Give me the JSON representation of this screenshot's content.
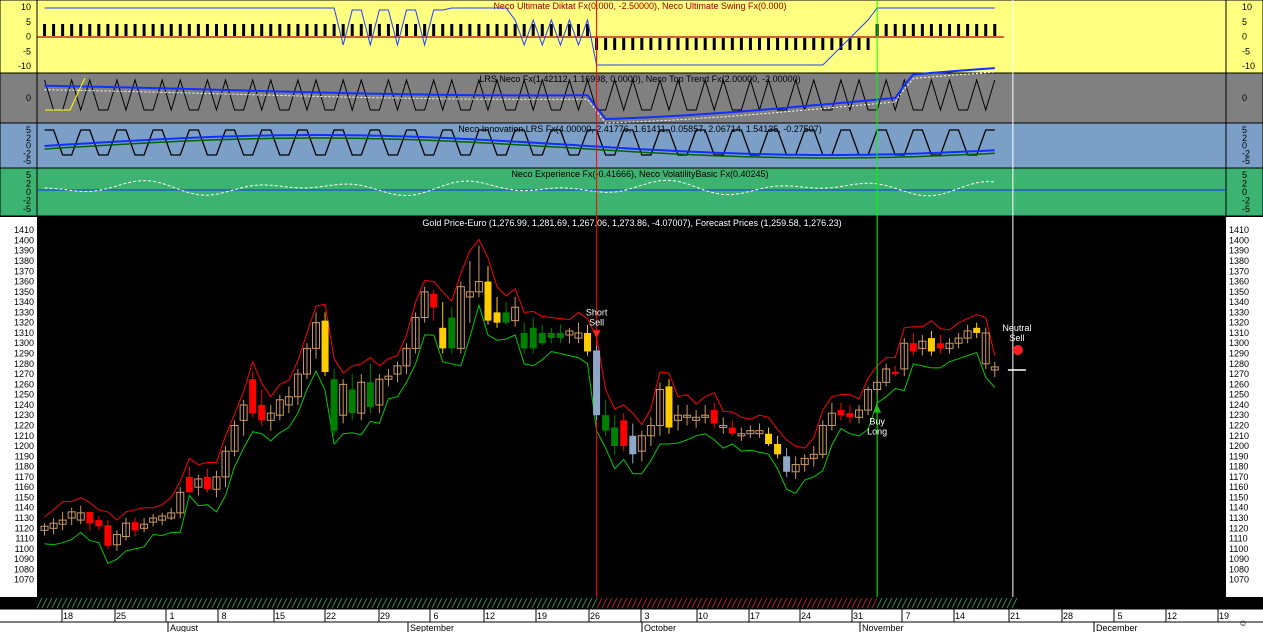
{
  "colors": {
    "panel1": "#ffff80",
    "panel2": "#808080",
    "panel3": "#7b9fc6",
    "panel4": "#3cb371",
    "price_bg": "#000000",
    "axis_bg": "#ffffff",
    "up_candle": "#ffffff",
    "down_red": "#ff0000",
    "green_candle": "#008000",
    "gold_candle": "#ffcc00",
    "blue_candle": "#8fa8c8",
    "upper_band": "#ff0000",
    "lower_band": "#00cc00",
    "vline_short": "#ff0000",
    "vline_buy": "#00ff00",
    "vline_current": "#ffffff"
  },
  "panels": [
    {
      "title": "Neco Ultimate Diktat Fx(0.000, -2.50000), Neco Ultimate Swing Fx(0.000)",
      "yticks": [
        "10",
        "5",
        "0",
        "-5",
        "-10"
      ]
    },
    {
      "title": "LRS Neco Fx(1.42112, 1.16998, 0.0000), Neco Top Trend Fx(2.00000, -2.00000)",
      "yticks": [
        "0"
      ]
    },
    {
      "title": "Neco Innovation LRS Fx(4.00000, 2.41776, 1.61411, 0.05857, 2.06714, 1.54135, -0.27507)",
      "yticks": [
        "5",
        "2",
        "0",
        "-2",
        "-5"
      ]
    },
    {
      "title": "Neco Experience Fx(-0.41666), Neco VolatilityBasic Fx(0.40245)",
      "yticks": [
        "5",
        "2",
        "0",
        "-2",
        "-5"
      ]
    }
  ],
  "chart_data": {
    "type": "candlestick",
    "title": "Gold Price-Euro (1,276.99, 1,281.69, 1,267.06, 1,273.86, -4.07007), Forecast Prices (1,259.58, 1,276.23)",
    "ylim": [
      1060,
      1415
    ],
    "yticks": [
      1410,
      1400,
      1390,
      1380,
      1370,
      1360,
      1350,
      1340,
      1330,
      1320,
      1310,
      1300,
      1290,
      1280,
      1270,
      1260,
      1250,
      1240,
      1230,
      1220,
      1210,
      1200,
      1190,
      1180,
      1170,
      1160,
      1150,
      1140,
      1130,
      1120,
      1110,
      1100,
      1090,
      1080,
      1070
    ],
    "x_day_labels": [
      "18",
      "25",
      "1",
      "8",
      "15",
      "22",
      "29",
      "6",
      "12",
      "19",
      "26",
      "3",
      "10",
      "17",
      "24",
      "31",
      "7",
      "14",
      "21",
      "28",
      "5",
      "12",
      "19"
    ],
    "x_month_labels": [
      "August",
      "September",
      "October",
      "November",
      "December"
    ],
    "candles": [
      {
        "o": 1118,
        "h": 1125,
        "l": 1113,
        "c": 1122,
        "t": "up"
      },
      {
        "o": 1120,
        "h": 1130,
        "l": 1114,
        "c": 1125,
        "t": "up"
      },
      {
        "o": 1124,
        "h": 1136,
        "l": 1118,
        "c": 1128,
        "t": "up"
      },
      {
        "o": 1130,
        "h": 1140,
        "l": 1123,
        "c": 1136,
        "t": "up"
      },
      {
        "o": 1135,
        "h": 1142,
        "l": 1124,
        "c": 1128,
        "t": "up"
      },
      {
        "o": 1125,
        "h": 1135,
        "l": 1118,
        "c": 1136,
        "t": "red"
      },
      {
        "o": 1128,
        "h": 1132,
        "l": 1118,
        "c": 1122,
        "t": "red"
      },
      {
        "o": 1123,
        "h": 1128,
        "l": 1100,
        "c": 1103,
        "t": "red"
      },
      {
        "o": 1104,
        "h": 1118,
        "l": 1098,
        "c": 1114,
        "t": "up"
      },
      {
        "o": 1112,
        "h": 1130,
        "l": 1108,
        "c": 1125,
        "t": "up"
      },
      {
        "o": 1126,
        "h": 1130,
        "l": 1112,
        "c": 1118,
        "t": "red"
      },
      {
        "o": 1120,
        "h": 1130,
        "l": 1116,
        "c": 1124,
        "t": "up"
      },
      {
        "o": 1126,
        "h": 1134,
        "l": 1122,
        "c": 1130,
        "t": "up"
      },
      {
        "o": 1128,
        "h": 1135,
        "l": 1123,
        "c": 1132,
        "t": "up"
      },
      {
        "o": 1130,
        "h": 1140,
        "l": 1128,
        "c": 1135,
        "t": "up"
      },
      {
        "o": 1135,
        "h": 1160,
        "l": 1130,
        "c": 1155,
        "t": "up"
      },
      {
        "o": 1170,
        "h": 1180,
        "l": 1160,
        "c": 1155,
        "t": "red"
      },
      {
        "o": 1160,
        "h": 1172,
        "l": 1152,
        "c": 1168,
        "t": "up"
      },
      {
        "o": 1170,
        "h": 1178,
        "l": 1155,
        "c": 1158,
        "t": "red"
      },
      {
        "o": 1158,
        "h": 1176,
        "l": 1150,
        "c": 1170,
        "t": "up"
      },
      {
        "o": 1170,
        "h": 1200,
        "l": 1160,
        "c": 1195,
        "t": "up"
      },
      {
        "o": 1195,
        "h": 1225,
        "l": 1190,
        "c": 1220,
        "t": "up"
      },
      {
        "o": 1225,
        "h": 1245,
        "l": 1210,
        "c": 1240,
        "t": "up"
      },
      {
        "o": 1265,
        "h": 1272,
        "l": 1228,
        "c": 1232,
        "t": "red"
      },
      {
        "o": 1240,
        "h": 1255,
        "l": 1220,
        "c": 1225,
        "t": "red"
      },
      {
        "o": 1225,
        "h": 1240,
        "l": 1215,
        "c": 1232,
        "t": "up"
      },
      {
        "o": 1230,
        "h": 1250,
        "l": 1225,
        "c": 1245,
        "t": "up"
      },
      {
        "o": 1240,
        "h": 1258,
        "l": 1232,
        "c": 1248,
        "t": "up"
      },
      {
        "o": 1248,
        "h": 1275,
        "l": 1240,
        "c": 1270,
        "t": "up"
      },
      {
        "o": 1270,
        "h": 1300,
        "l": 1265,
        "c": 1295,
        "t": "up"
      },
      {
        "o": 1295,
        "h": 1330,
        "l": 1285,
        "c": 1320,
        "t": "up"
      },
      {
        "o": 1322,
        "h": 1330,
        "l": 1268,
        "c": 1272,
        "t": "gold"
      },
      {
        "o": 1265,
        "h": 1275,
        "l": 1210,
        "c": 1215,
        "t": "green"
      },
      {
        "o": 1230,
        "h": 1265,
        "l": 1222,
        "c": 1260,
        "t": "up"
      },
      {
        "o": 1255,
        "h": 1270,
        "l": 1225,
        "c": 1232,
        "t": "green"
      },
      {
        "o": 1232,
        "h": 1270,
        "l": 1225,
        "c": 1262,
        "t": "up"
      },
      {
        "o": 1262,
        "h": 1280,
        "l": 1232,
        "c": 1238,
        "t": "green"
      },
      {
        "o": 1240,
        "h": 1270,
        "l": 1232,
        "c": 1265,
        "t": "up"
      },
      {
        "o": 1265,
        "h": 1275,
        "l": 1258,
        "c": 1268,
        "t": "up"
      },
      {
        "o": 1270,
        "h": 1282,
        "l": 1262,
        "c": 1278,
        "t": "up"
      },
      {
        "o": 1278,
        "h": 1300,
        "l": 1270,
        "c": 1295,
        "t": "up"
      },
      {
        "o": 1295,
        "h": 1330,
        "l": 1290,
        "c": 1325,
        "t": "up"
      },
      {
        "o": 1325,
        "h": 1355,
        "l": 1320,
        "c": 1350,
        "t": "up"
      },
      {
        "o": 1348,
        "h": 1352,
        "l": 1322,
        "c": 1335,
        "t": "red"
      },
      {
        "o": 1315,
        "h": 1340,
        "l": 1290,
        "c": 1295,
        "t": "gold"
      },
      {
        "o": 1325,
        "h": 1335,
        "l": 1290,
        "c": 1295,
        "t": "green"
      },
      {
        "o": 1295,
        "h": 1360,
        "l": 1290,
        "c": 1355,
        "t": "up"
      },
      {
        "o": 1345,
        "h": 1380,
        "l": 1320,
        "c": 1350,
        "t": "up"
      },
      {
        "o": 1350,
        "h": 1395,
        "l": 1345,
        "c": 1360,
        "t": "up"
      },
      {
        "o": 1360,
        "h": 1375,
        "l": 1318,
        "c": 1322,
        "t": "gold"
      },
      {
        "o": 1330,
        "h": 1345,
        "l": 1315,
        "c": 1320,
        "t": "gold"
      },
      {
        "o": 1330,
        "h": 1340,
        "l": 1318,
        "c": 1320,
        "t": "green"
      },
      {
        "o": 1322,
        "h": 1345,
        "l": 1316,
        "c": 1335,
        "t": "up"
      },
      {
        "o": 1310,
        "h": 1320,
        "l": 1290,
        "c": 1295,
        "t": "green"
      },
      {
        "o": 1315,
        "h": 1325,
        "l": 1290,
        "c": 1295,
        "t": "green"
      },
      {
        "o": 1310,
        "h": 1318,
        "l": 1298,
        "c": 1300,
        "t": "green"
      },
      {
        "o": 1305,
        "h": 1315,
        "l": 1300,
        "c": 1310,
        "t": "green"
      },
      {
        "o": 1310,
        "h": 1318,
        "l": 1300,
        "c": 1305,
        "t": "green"
      },
      {
        "o": 1308,
        "h": 1315,
        "l": 1300,
        "c": 1312,
        "t": "up"
      },
      {
        "o": 1310,
        "h": 1320,
        "l": 1300,
        "c": 1305,
        "t": "up"
      },
      {
        "o": 1310,
        "h": 1318,
        "l": 1288,
        "c": 1292,
        "t": "gold"
      },
      {
        "o": 1293,
        "h": 1298,
        "l": 1225,
        "c": 1230,
        "t": "blue"
      },
      {
        "o": 1230,
        "h": 1245,
        "l": 1210,
        "c": 1215,
        "t": "green"
      },
      {
        "o": 1218,
        "h": 1230,
        "l": 1192,
        "c": 1200,
        "t": "green"
      },
      {
        "o": 1200,
        "h": 1232,
        "l": 1195,
        "c": 1225,
        "t": "red"
      },
      {
        "o": 1210,
        "h": 1222,
        "l": 1183,
        "c": 1192,
        "t": "blue"
      },
      {
        "o": 1195,
        "h": 1215,
        "l": 1185,
        "c": 1210,
        "t": "up"
      },
      {
        "o": 1210,
        "h": 1228,
        "l": 1200,
        "c": 1220,
        "t": "up"
      },
      {
        "o": 1220,
        "h": 1262,
        "l": 1210,
        "c": 1255,
        "t": "up"
      },
      {
        "o": 1258,
        "h": 1265,
        "l": 1212,
        "c": 1218,
        "t": "gold"
      },
      {
        "o": 1225,
        "h": 1240,
        "l": 1215,
        "c": 1230,
        "t": "up"
      },
      {
        "o": 1230,
        "h": 1240,
        "l": 1220,
        "c": 1228,
        "t": "up"
      },
      {
        "o": 1225,
        "h": 1235,
        "l": 1218,
        "c": 1228,
        "t": "up"
      },
      {
        "o": 1228,
        "h": 1240,
        "l": 1222,
        "c": 1230,
        "t": "up"
      },
      {
        "o": 1235,
        "h": 1242,
        "l": 1218,
        "c": 1222,
        "t": "red"
      },
      {
        "o": 1220,
        "h": 1228,
        "l": 1212,
        "c": 1218,
        "t": "up"
      },
      {
        "o": 1218,
        "h": 1225,
        "l": 1210,
        "c": 1212,
        "t": "red"
      },
      {
        "o": 1210,
        "h": 1218,
        "l": 1205,
        "c": 1212,
        "t": "up"
      },
      {
        "o": 1212,
        "h": 1220,
        "l": 1208,
        "c": 1215,
        "t": "up"
      },
      {
        "o": 1215,
        "h": 1222,
        "l": 1208,
        "c": 1212,
        "t": "up"
      },
      {
        "o": 1212,
        "h": 1218,
        "l": 1200,
        "c": 1202,
        "t": "gold"
      },
      {
        "o": 1202,
        "h": 1210,
        "l": 1188,
        "c": 1192,
        "t": "gold"
      },
      {
        "o": 1190,
        "h": 1198,
        "l": 1170,
        "c": 1175,
        "t": "blue"
      },
      {
        "o": 1175,
        "h": 1190,
        "l": 1168,
        "c": 1182,
        "t": "up"
      },
      {
        "o": 1182,
        "h": 1192,
        "l": 1175,
        "c": 1188,
        "t": "up"
      },
      {
        "o": 1188,
        "h": 1200,
        "l": 1180,
        "c": 1192,
        "t": "up"
      },
      {
        "o": 1192,
        "h": 1225,
        "l": 1188,
        "c": 1220,
        "t": "up"
      },
      {
        "o": 1220,
        "h": 1242,
        "l": 1215,
        "c": 1232,
        "t": "up"
      },
      {
        "o": 1235,
        "h": 1242,
        "l": 1225,
        "c": 1230,
        "t": "red"
      },
      {
        "o": 1232,
        "h": 1240,
        "l": 1222,
        "c": 1228,
        "t": "red"
      },
      {
        "o": 1228,
        "h": 1240,
        "l": 1222,
        "c": 1235,
        "t": "up"
      },
      {
        "o": 1235,
        "h": 1258,
        "l": 1230,
        "c": 1255,
        "t": "up"
      },
      {
        "o": 1255,
        "h": 1268,
        "l": 1250,
        "c": 1262,
        "t": "up"
      },
      {
        "o": 1262,
        "h": 1280,
        "l": 1258,
        "c": 1275,
        "t": "up"
      },
      {
        "o": 1272,
        "h": 1278,
        "l": 1268,
        "c": 1270,
        "t": "red"
      },
      {
        "o": 1275,
        "h": 1305,
        "l": 1268,
        "c": 1300,
        "t": "up"
      },
      {
        "o": 1300,
        "h": 1310,
        "l": 1288,
        "c": 1292,
        "t": "red"
      },
      {
        "o": 1295,
        "h": 1308,
        "l": 1288,
        "c": 1302,
        "t": "up"
      },
      {
        "o": 1305,
        "h": 1312,
        "l": 1288,
        "c": 1292,
        "t": "gold"
      },
      {
        "o": 1300,
        "h": 1308,
        "l": 1290,
        "c": 1295,
        "t": "red"
      },
      {
        "o": 1295,
        "h": 1305,
        "l": 1290,
        "c": 1300,
        "t": "up"
      },
      {
        "o": 1300,
        "h": 1310,
        "l": 1295,
        "c": 1305,
        "t": "up"
      },
      {
        "o": 1305,
        "h": 1318,
        "l": 1300,
        "c": 1312,
        "t": "up"
      },
      {
        "o": 1315,
        "h": 1320,
        "l": 1305,
        "c": 1310,
        "t": "gold"
      },
      {
        "o": 1310,
        "h": 1315,
        "l": 1275,
        "c": 1280,
        "t": "up"
      },
      {
        "o": 1277,
        "h": 1282,
        "l": 1267,
        "c": 1274,
        "t": "up"
      }
    ],
    "annotations": [
      {
        "text": "Short",
        "text2": "Sell",
        "index": 61,
        "kind": "sell"
      },
      {
        "text": "Buy",
        "text2": "Long",
        "index": 92,
        "kind": "buy"
      },
      {
        "text": "Neutral",
        "text2": "Sell",
        "index": 107,
        "kind": "neutral"
      }
    ],
    "vlines": [
      {
        "index": 61,
        "kind": "short"
      },
      {
        "index": 92,
        "kind": "buy"
      },
      {
        "index": 107,
        "kind": "current"
      }
    ]
  }
}
